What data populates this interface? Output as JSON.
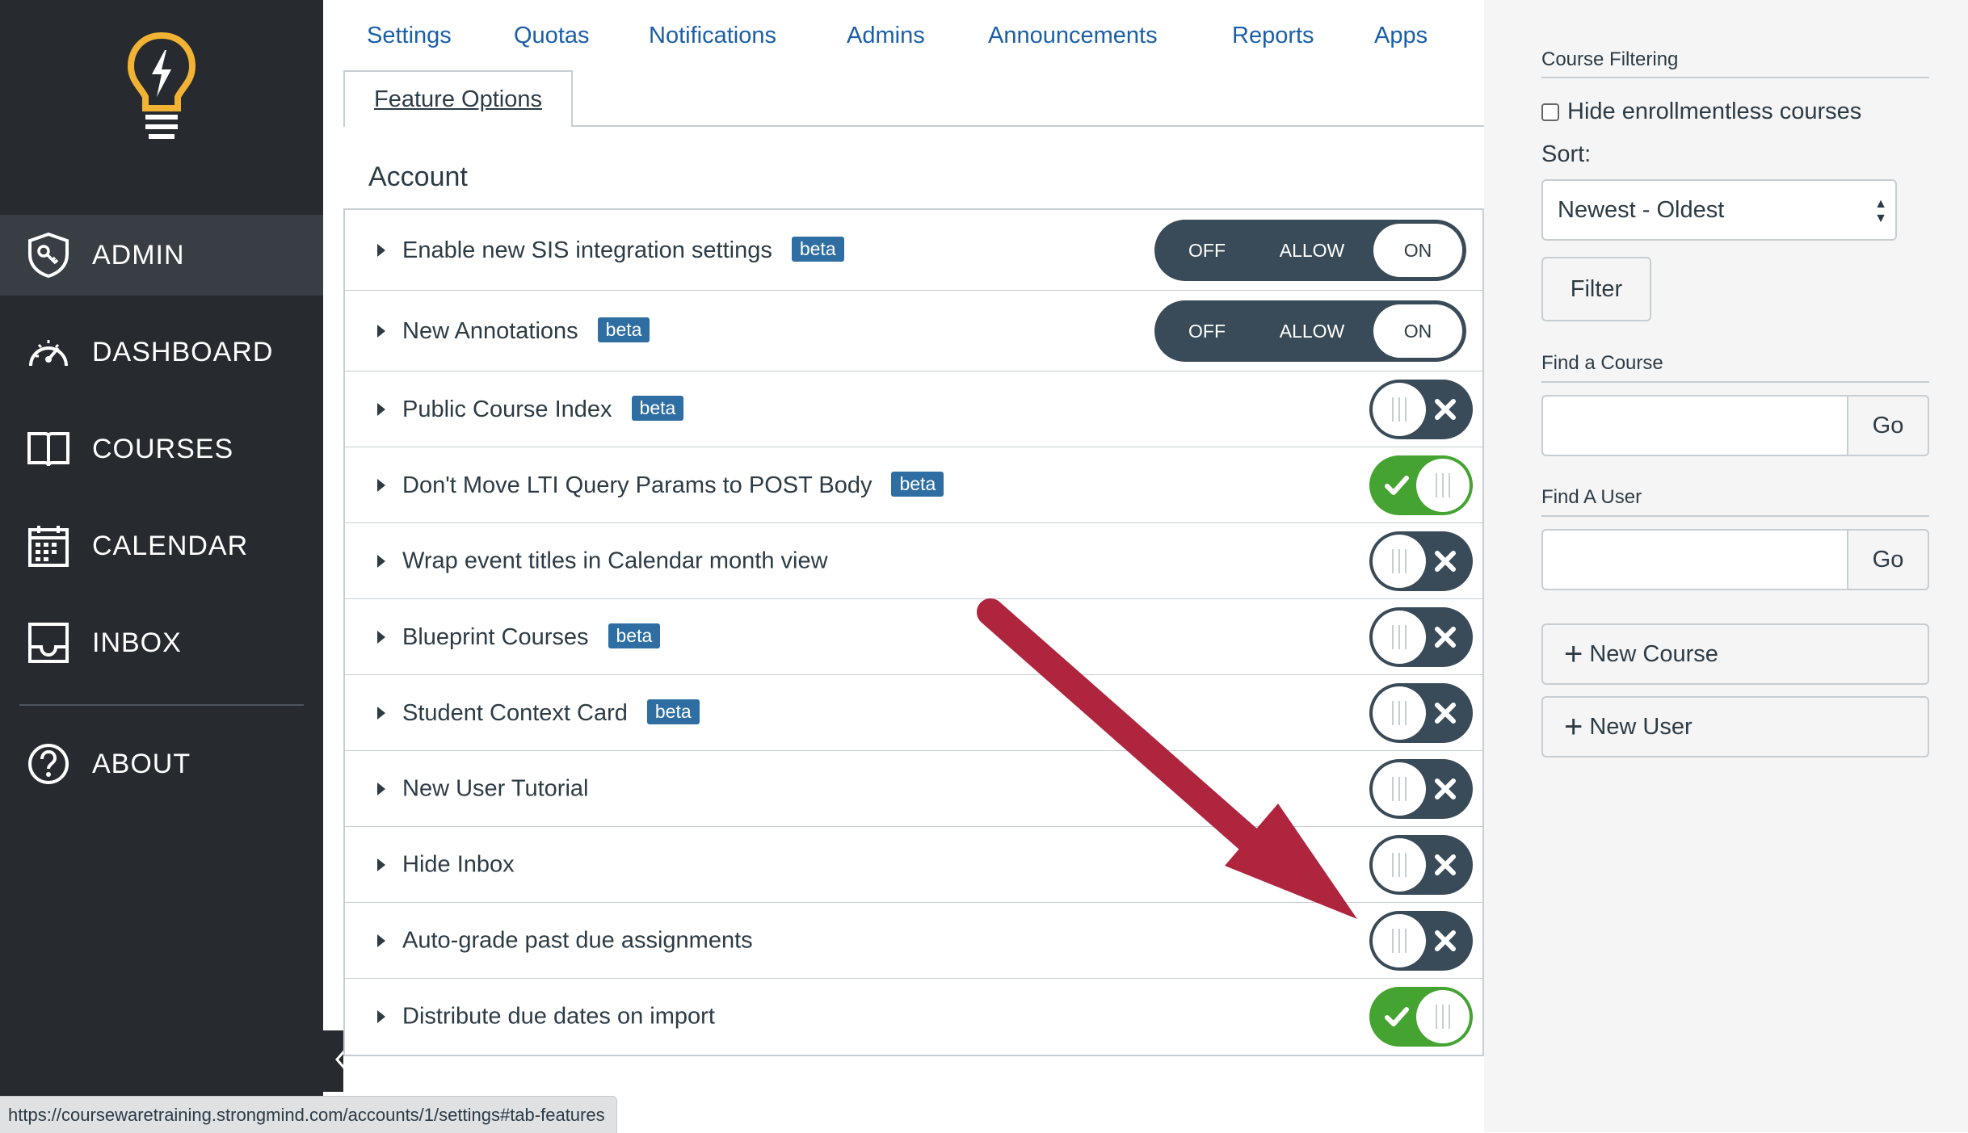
{
  "global_nav": {
    "items": [
      {
        "label": "ADMIN",
        "icon": "shield-icon",
        "active": true
      },
      {
        "label": "DASHBOARD",
        "icon": "speedometer-icon"
      },
      {
        "label": "COURSES",
        "icon": "book-icon"
      },
      {
        "label": "CALENDAR",
        "icon": "calendar-icon"
      },
      {
        "label": "INBOX",
        "icon": "inbox-icon"
      },
      {
        "label": "ABOUT",
        "icon": "question-icon"
      }
    ],
    "logo_icon": "lightbulb-icon",
    "colors": {
      "background": "#272b2f",
      "active": "#393e44",
      "logo": "#f2b334"
    }
  },
  "tabs": {
    "items": [
      "Settings",
      "Quotas",
      "Notifications",
      "Admins",
      "Announcements",
      "Reports",
      "Apps"
    ],
    "active": "Feature Options"
  },
  "section": {
    "title": "Account"
  },
  "features": [
    {
      "name": "Enable new SIS integration settings",
      "beta": "beta",
      "control": "tri",
      "state": "ON"
    },
    {
      "name": "New Annotations",
      "beta": "beta",
      "control": "tri",
      "state": "ON"
    },
    {
      "name": "Public Course Index",
      "beta": "beta",
      "control": "toggle",
      "state": "off"
    },
    {
      "name": "Don't Move LTI Query Params to POST Body",
      "beta": "beta",
      "control": "toggle",
      "state": "on"
    },
    {
      "name": "Wrap event titles in Calendar month view",
      "beta": null,
      "control": "toggle",
      "state": "off"
    },
    {
      "name": "Blueprint Courses",
      "beta": "beta",
      "control": "toggle",
      "state": "off"
    },
    {
      "name": "Student Context Card",
      "beta": "beta",
      "control": "toggle",
      "state": "off"
    },
    {
      "name": "New User Tutorial",
      "beta": null,
      "control": "toggle",
      "state": "off"
    },
    {
      "name": "Hide Inbox",
      "beta": null,
      "control": "toggle",
      "state": "off"
    },
    {
      "name": "Auto-grade past due assignments",
      "beta": null,
      "control": "toggle",
      "state": "off"
    },
    {
      "name": "Distribute due dates on import",
      "beta": null,
      "control": "toggle",
      "state": "on"
    }
  ],
  "tri_labels": {
    "off": "OFF",
    "allow": "ALLOW",
    "on": "ON"
  },
  "sidebar": {
    "course_filtering": {
      "heading": "Course Filtering",
      "hide_checkbox_label": "Hide enrollmentless courses",
      "hide_checked": false,
      "sort_label": "Sort:",
      "sort_value": "Newest - Oldest",
      "filter_button": "Filter"
    },
    "find_course": {
      "heading": "Find a Course",
      "value": "",
      "go": "Go"
    },
    "find_user": {
      "heading": "Find A User",
      "value": "",
      "go": "Go"
    },
    "new_course": "New Course",
    "new_user": "New User"
  },
  "status_bar": {
    "url": "https://coursewaretraining.strongmind.com/accounts/1/settings#tab-features"
  },
  "colors": {
    "link": "#1b5fa8",
    "beta_badge": "#2f6ea3",
    "toggle_off": "#394b58",
    "toggle_on": "#44a331",
    "annotation_arrow": "#b0253e",
    "sidebar_bg": "#f5f5f5"
  }
}
